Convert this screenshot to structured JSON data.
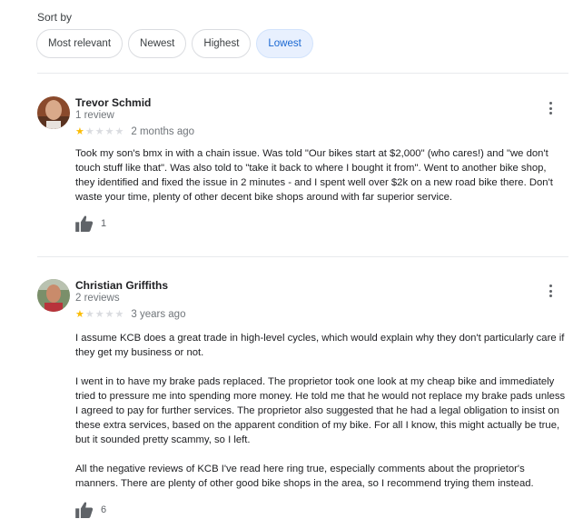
{
  "sort": {
    "label": "Sort by",
    "options": [
      "Most relevant",
      "Newest",
      "Highest",
      "Lowest"
    ],
    "selected": "Lowest"
  },
  "reviews": [
    {
      "name": "Trevor Schmid",
      "review_count": "1 review",
      "rating": 1,
      "max_rating": 5,
      "time": "2 months ago",
      "paragraphs": [
        "Took my son's bmx in with a chain issue. Was told \"Our bikes start at $2,000\" (who cares!) and \"we don't touch stuff like that\". Was also told to \"take it back to where I bought it from\". Went to another bike shop, they identified and fixed the issue in 2 minutes - and I spent well over $2k on a new road bike there. Don't waste your time, plenty of other decent bike shops around with far superior service."
      ],
      "likes": "1"
    },
    {
      "name": "Christian Griffiths",
      "review_count": "2 reviews",
      "rating": 1,
      "max_rating": 5,
      "time": "3 years ago",
      "paragraphs": [
        "I assume KCB does a great trade in high-level cycles, which would explain why they don't particularly care if they get my business or not.",
        "I went in to have my brake pads replaced. The proprietor took one look at my cheap bike and immediately tried to pressure me into spending more money. He told me that he would not replace my brake pads unless I agreed to pay for further services. The proprietor also suggested that he had a legal obligation to insist on these extra services, based on the apparent condition of my bike. For all I know, this might actually be true, but it sounded pretty scammy, so I left.",
        "All the negative reviews of KCB I've read here ring true, especially comments about the proprietor's manners. There are plenty of other good bike shops in the area, so I recommend trying them instead."
      ],
      "likes": "6"
    }
  ],
  "colors": {
    "star_on": "#fbbc04",
    "star_off": "#dadce0",
    "chip_active_bg": "#e8f0fe",
    "chip_active_text": "#1967d2"
  }
}
